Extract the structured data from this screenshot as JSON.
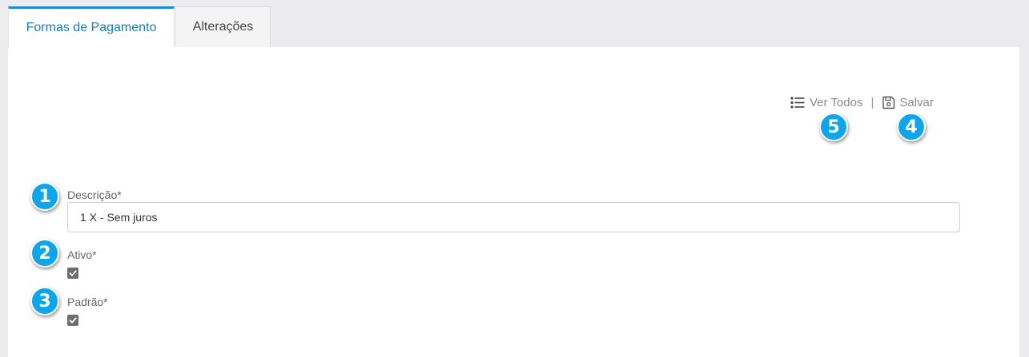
{
  "tabs": [
    {
      "label": "Formas de Pagamento",
      "active": true
    },
    {
      "label": "Alterações",
      "active": false
    }
  ],
  "toolbar": {
    "view_all_label": "Ver Todos",
    "separator": "|",
    "save_label": "Salvar",
    "view_all_icon": "list-icon",
    "save_icon": "floppy-disk-icon"
  },
  "form": {
    "descricao": {
      "label": "Descrição*",
      "value": "1 X - Sem juros"
    },
    "ativo": {
      "label": "Ativo*",
      "checked": true
    },
    "padrao": {
      "label": "Padrão*",
      "checked": true
    }
  },
  "callouts": [
    "1",
    "2",
    "3",
    "4",
    "5"
  ],
  "colors": {
    "accent": "#1a8cd8",
    "badge": "#0ea5ea",
    "background": "#ececee"
  }
}
